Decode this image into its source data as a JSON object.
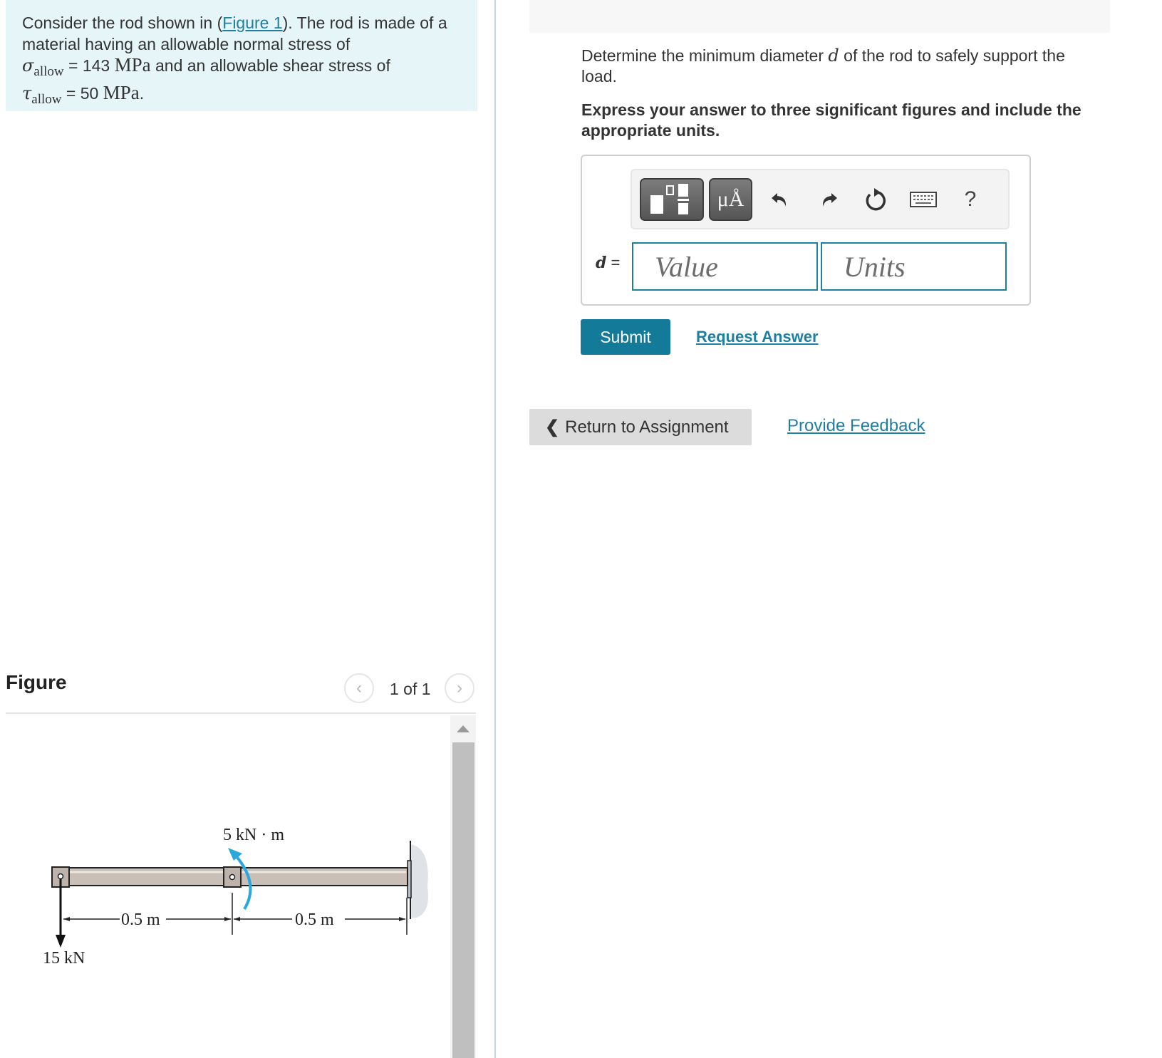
{
  "problem": {
    "intro_before_link": "Consider the rod shown in (",
    "figure_link": "Figure 1",
    "intro_after_link": "). The rod is made of a material having an allowable normal stress of",
    "sigma_symbol": "σ",
    "sigma_sub": "allow",
    "sigma_eq": " = 143 ",
    "sigma_unit": "MPa",
    "mid_text": " and an allowable shear stress of",
    "tau_symbol": "τ",
    "tau_sub": "allow",
    "tau_eq": " = 50 ",
    "tau_unit": "MPa",
    "end_text": "."
  },
  "figure": {
    "title": "Figure",
    "pager_label": "1 of 1",
    "prev_glyph": "‹",
    "next_glyph": "›",
    "labels": {
      "moment": "5 kN · m",
      "span_left": "0.5 m",
      "span_right": "0.5 m",
      "force": "15 kN"
    },
    "colors": {
      "rod": "#c9bfb7",
      "moment_arrow": "#2aa7dc",
      "wall": "#dfe2e6"
    }
  },
  "question": {
    "text_before_var": "Determine the minimum diameter ",
    "var": "d",
    "text_after_var": " of the rod to safely support the load.",
    "instruction": "Express your answer to three significant figures and include the appropriate units."
  },
  "answer": {
    "var_label": "d",
    "eq_sign": " =",
    "value_placeholder": "Value",
    "value": "",
    "units_placeholder": "Units",
    "units": "",
    "toolbar": {
      "templates_icon": "templates-icon",
      "units_label": "μÅ",
      "undo_icon": "undo-icon",
      "redo_icon": "redo-icon",
      "reset_icon": "reset-icon",
      "keyboard_icon": "keyboard-icon",
      "help_label": "?"
    }
  },
  "actions": {
    "submit": "Submit",
    "request_answer": "Request Answer",
    "return_glyph": "❮",
    "return": "Return to Assignment",
    "feedback": "Provide Feedback"
  },
  "theme": {
    "accent": "#137a9a",
    "link": "#1f7fa3",
    "intro_bg": "#e6f5f7"
  }
}
